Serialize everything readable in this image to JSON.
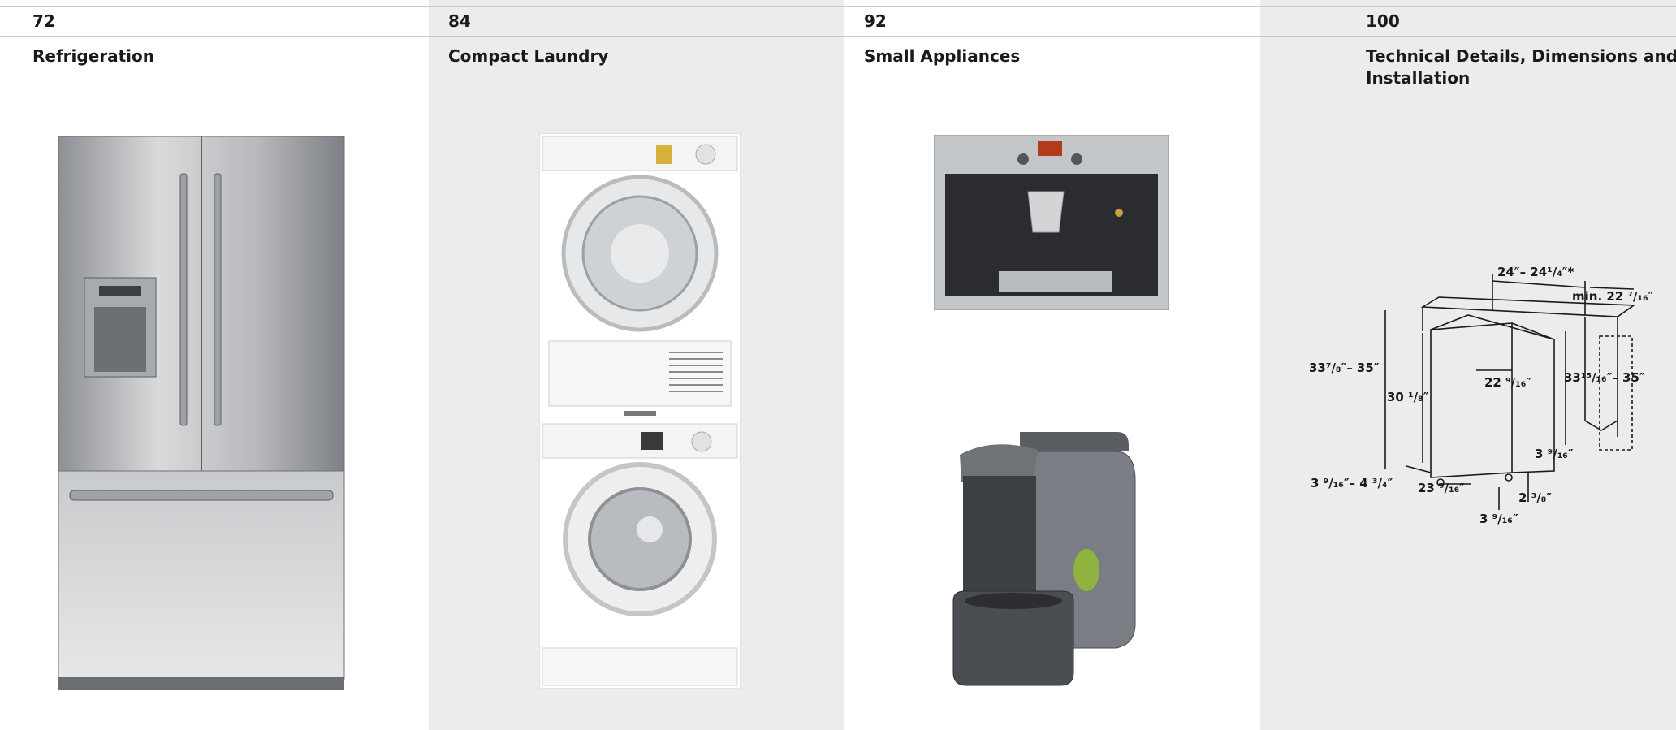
{
  "columns": [
    {
      "page": "72",
      "title": "Refrigeration",
      "image": "french-door-refrigerator"
    },
    {
      "page": "84",
      "title": "Compact Laundry",
      "image": "stacked-washer-dryer"
    },
    {
      "page": "92",
      "title": "Small Appliances",
      "image": "coffee-machines"
    },
    {
      "page": "100",
      "title": "Technical Details, Dimensions and Installation",
      "image": "dishwasher-dimension-diagram"
    }
  ],
  "diagram_labels": {
    "width_total": "24″– 24¹/₄″*",
    "min_depth": "min. 22 ⁷/₁₆″",
    "height_left": "33⁷/₈″– 35″",
    "height_right": "33¹⁵/₁₆″– 35″",
    "inner_height": "30 ¹/₈″",
    "inner_depth": "22 ⁹/₁₆″",
    "foot_right": "3 ⁹/₁₆″",
    "foot_left": "3 ⁹/₁₆″– 4 ³/₄″",
    "depth_bottom": "23 ⁹/₁₆″",
    "toe_kick": "2 ³/₈″",
    "bottom_offset": "3 ⁹/₁₆″"
  }
}
